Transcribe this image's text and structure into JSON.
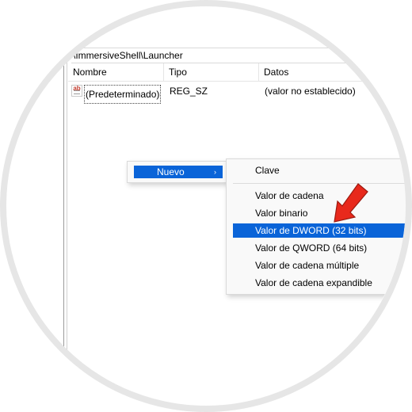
{
  "path_bar": {
    "text": "\\ImmersiveShell\\Launcher"
  },
  "columns": {
    "name": "Nombre",
    "type": "Tipo",
    "data": "Datos"
  },
  "rows": [
    {
      "icon": "string-value-icon",
      "icon_text": "ab",
      "name": "(Predeterminado)",
      "type": "REG_SZ",
      "data": "(valor no establecido)"
    }
  ],
  "context_menu": {
    "item_label": "Nuevo",
    "arrow_glyph": "›"
  },
  "submenu": {
    "items": [
      {
        "label": "Clave",
        "highlighted": false
      },
      {
        "label": "Valor de cadena",
        "highlighted": false
      },
      {
        "label": "Valor binario",
        "highlighted": false
      },
      {
        "label": "Valor de DWORD (32 bits)",
        "highlighted": true
      },
      {
        "label": "Valor de QWORD (64 bits)",
        "highlighted": false
      },
      {
        "label": "Valor de cadena múltiple",
        "highlighted": false
      },
      {
        "label": "Valor de cadena expandible",
        "highlighted": false
      }
    ]
  },
  "colors": {
    "highlight": "#0a64d8",
    "annotation_arrow": "#e8291c"
  }
}
